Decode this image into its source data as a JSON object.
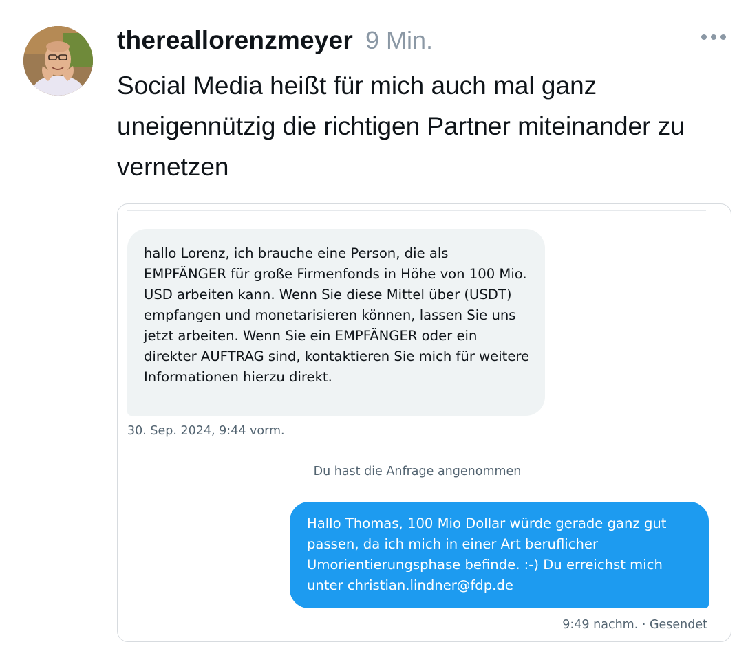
{
  "post": {
    "username": "thereallorenzmeyer",
    "time": "9 Min.",
    "text": "Social Media heißt für mich auch mal ganz uneigennützig die richtigen Partner miteinander zu vernetzen",
    "avatar": "profile-photo",
    "more_icon": "more-horizontal-icon"
  },
  "chat": {
    "incoming_message": "hallo Lorenz, ich brauche eine Person, die als EMPFÄNGER für große Firmenfonds in Höhe von 100 Mio. USD arbeiten kann. Wenn Sie diese Mittel über (USDT) empfangen und monetarisieren können, lassen Sie uns jetzt arbeiten. Wenn Sie ein EMPFÄNGER oder ein direkter AUFTRAG sind, kontaktieren Sie mich für weitere Informationen hierzu direkt.",
    "incoming_timestamp": "30. Sep. 2024, 9:44 vorm.",
    "request_notice": "Du hast die Anfrage angenommen",
    "outgoing_message": "Hallo Thomas, 100 Mio Dollar würde gerade ganz gut passen, da ich mich in einer Art beruflicher Umorientierungsphase befinde. :-) Du erreichst mich unter christian.lindner@fdp.de",
    "outgoing_timestamp": "9:49 nachm. · Gesendet"
  },
  "colors": {
    "accent_blue": "#1d9bf0",
    "incoming_bubble": "#eff3f4",
    "secondary_text": "#536471",
    "meta_text": "#8b98a5"
  }
}
